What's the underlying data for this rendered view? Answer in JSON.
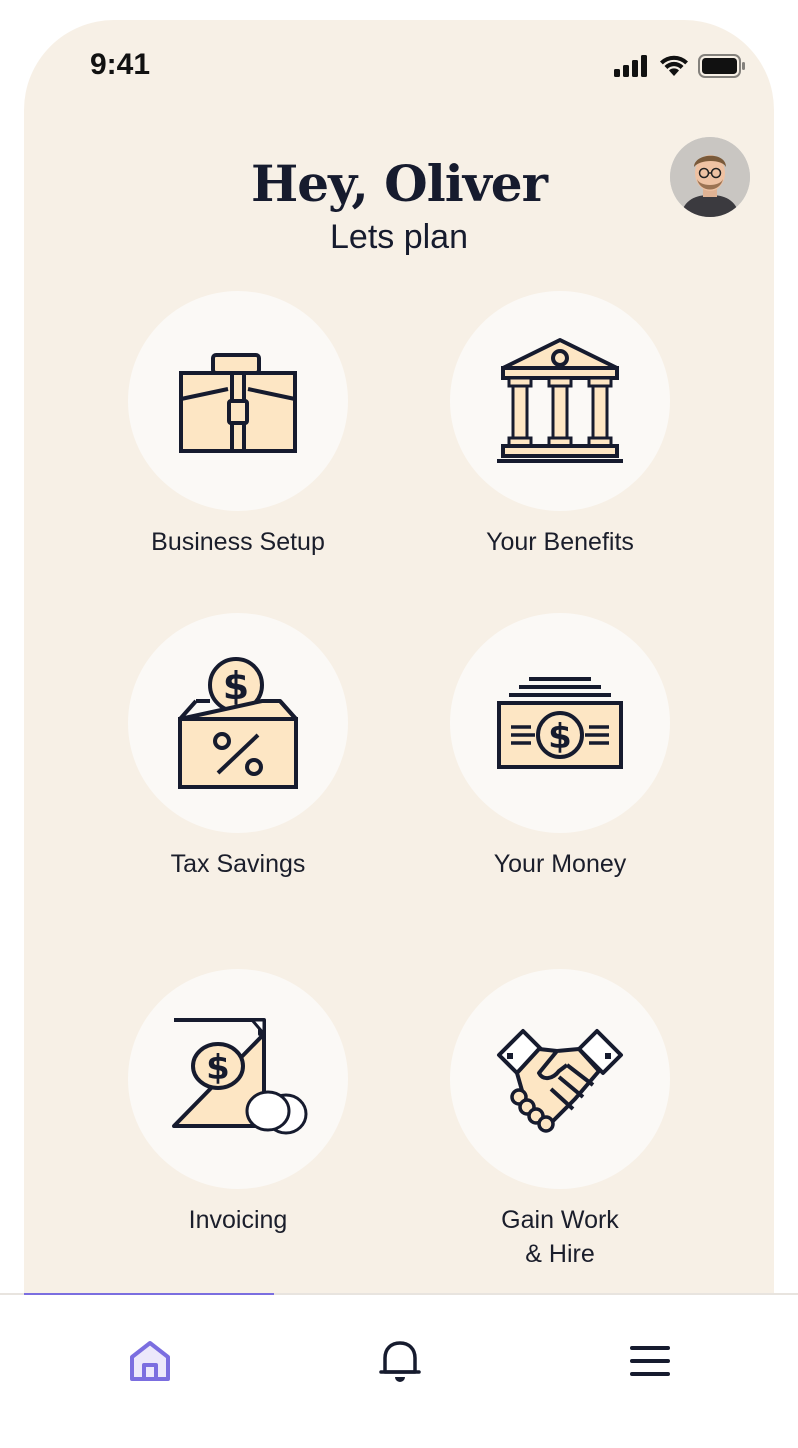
{
  "status_bar": {
    "time": "9:41"
  },
  "header": {
    "greeting": "Hey, Oliver",
    "subtitle": "Lets plan"
  },
  "tiles": [
    {
      "label": "Business Setup",
      "icon": "briefcase-icon"
    },
    {
      "label": "Your Benefits",
      "icon": "bank-building-icon"
    },
    {
      "label": "Tax Savings",
      "icon": "tax-box-coin-icon"
    },
    {
      "label": "Your Money",
      "icon": "cash-stack-icon"
    },
    {
      "label": "Invoicing",
      "icon": "invoice-document-icon"
    },
    {
      "label_line1": "Gain Work",
      "label_line2": "& Hire",
      "icon": "handshake-icon"
    }
  ],
  "tabbar": {
    "active_tab": "home",
    "items": [
      "home-icon",
      "bell-icon",
      "menu-icon"
    ],
    "accent_color": "#7b6ee0"
  },
  "colors": {
    "background": "#f7f0e6",
    "icon_fill": "#fde6c4",
    "ink": "#161b2e"
  }
}
